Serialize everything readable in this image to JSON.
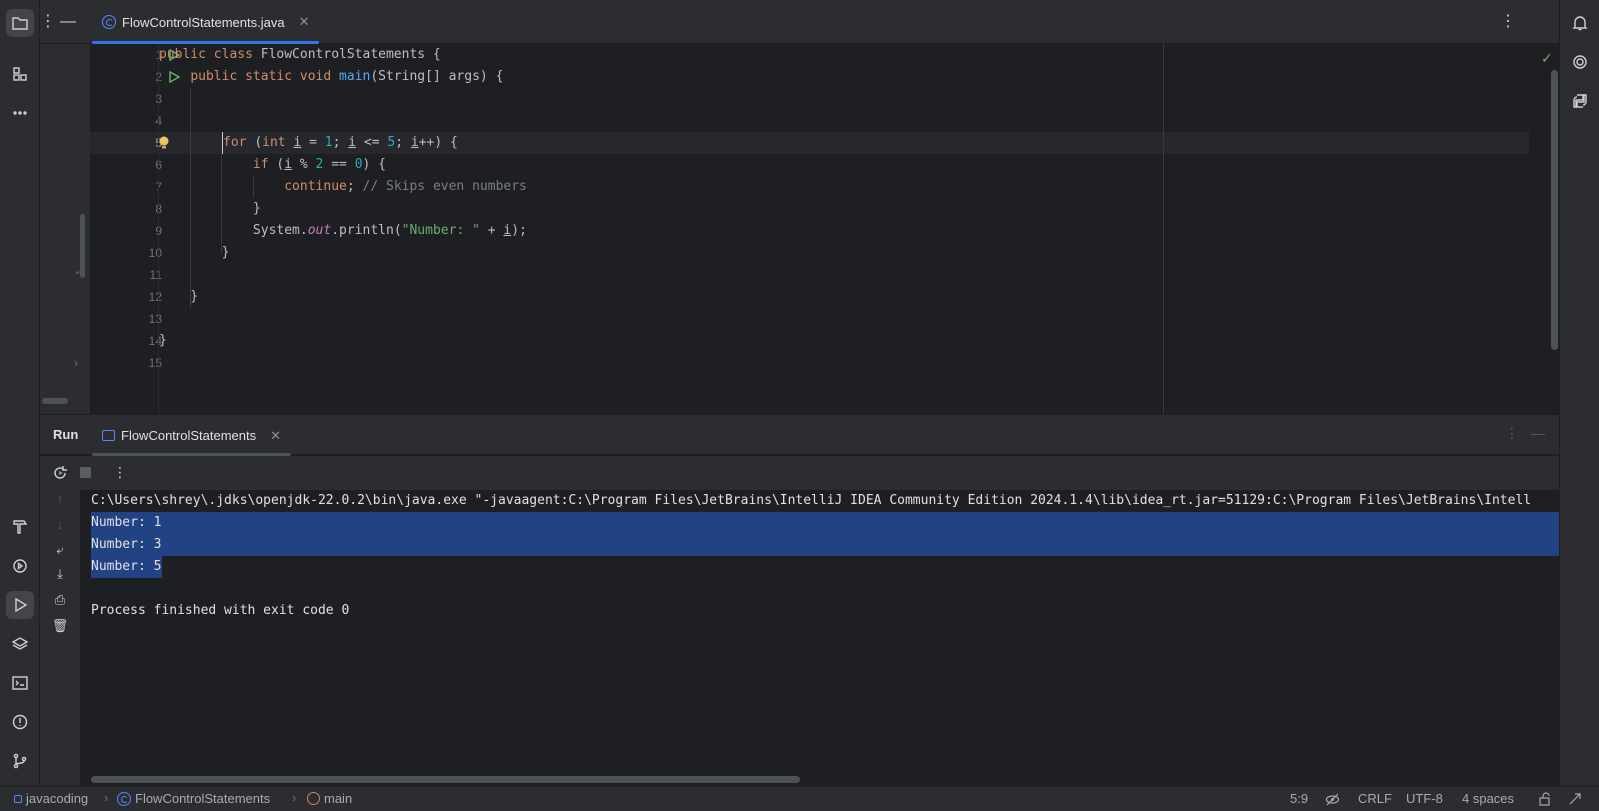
{
  "editor": {
    "tab_label": "FlowControlStatements.java",
    "line_numbers": [
      "1",
      "2",
      "3",
      "4",
      "5",
      "6",
      "7",
      "8",
      "9",
      "10",
      "11",
      "12",
      "13",
      "14",
      "15"
    ],
    "current_line": "5"
  },
  "run": {
    "title": "Run",
    "tab_label": "FlowControlStatements",
    "command": "C:\\Users\\shrey\\.jdks\\openjdk-22.0.2\\bin\\java.exe \"-javaagent:C:\\Program Files\\JetBrains\\IntelliJ IDEA Community Edition 2024.1.4\\lib\\idea_rt.jar=51129:C:\\Program Files\\JetBrains\\Intell",
    "output": [
      "Number: 1",
      "Number: 3",
      "Number: 5"
    ],
    "exit_message": "Process finished with exit code 0"
  },
  "status": {
    "project": "javacoding",
    "class": "FlowControlStatements",
    "method": "main",
    "position": "5:9",
    "line_separator": "CRLF",
    "encoding": "UTF-8",
    "indent": "4 spaces"
  },
  "colors": {
    "accent": "#3574f0",
    "selection": "#214283",
    "keyword": "#cf8e6d",
    "function": "#56a8f5",
    "number": "#2aacb8",
    "string": "#6aab73",
    "comment": "#7a7e85"
  }
}
